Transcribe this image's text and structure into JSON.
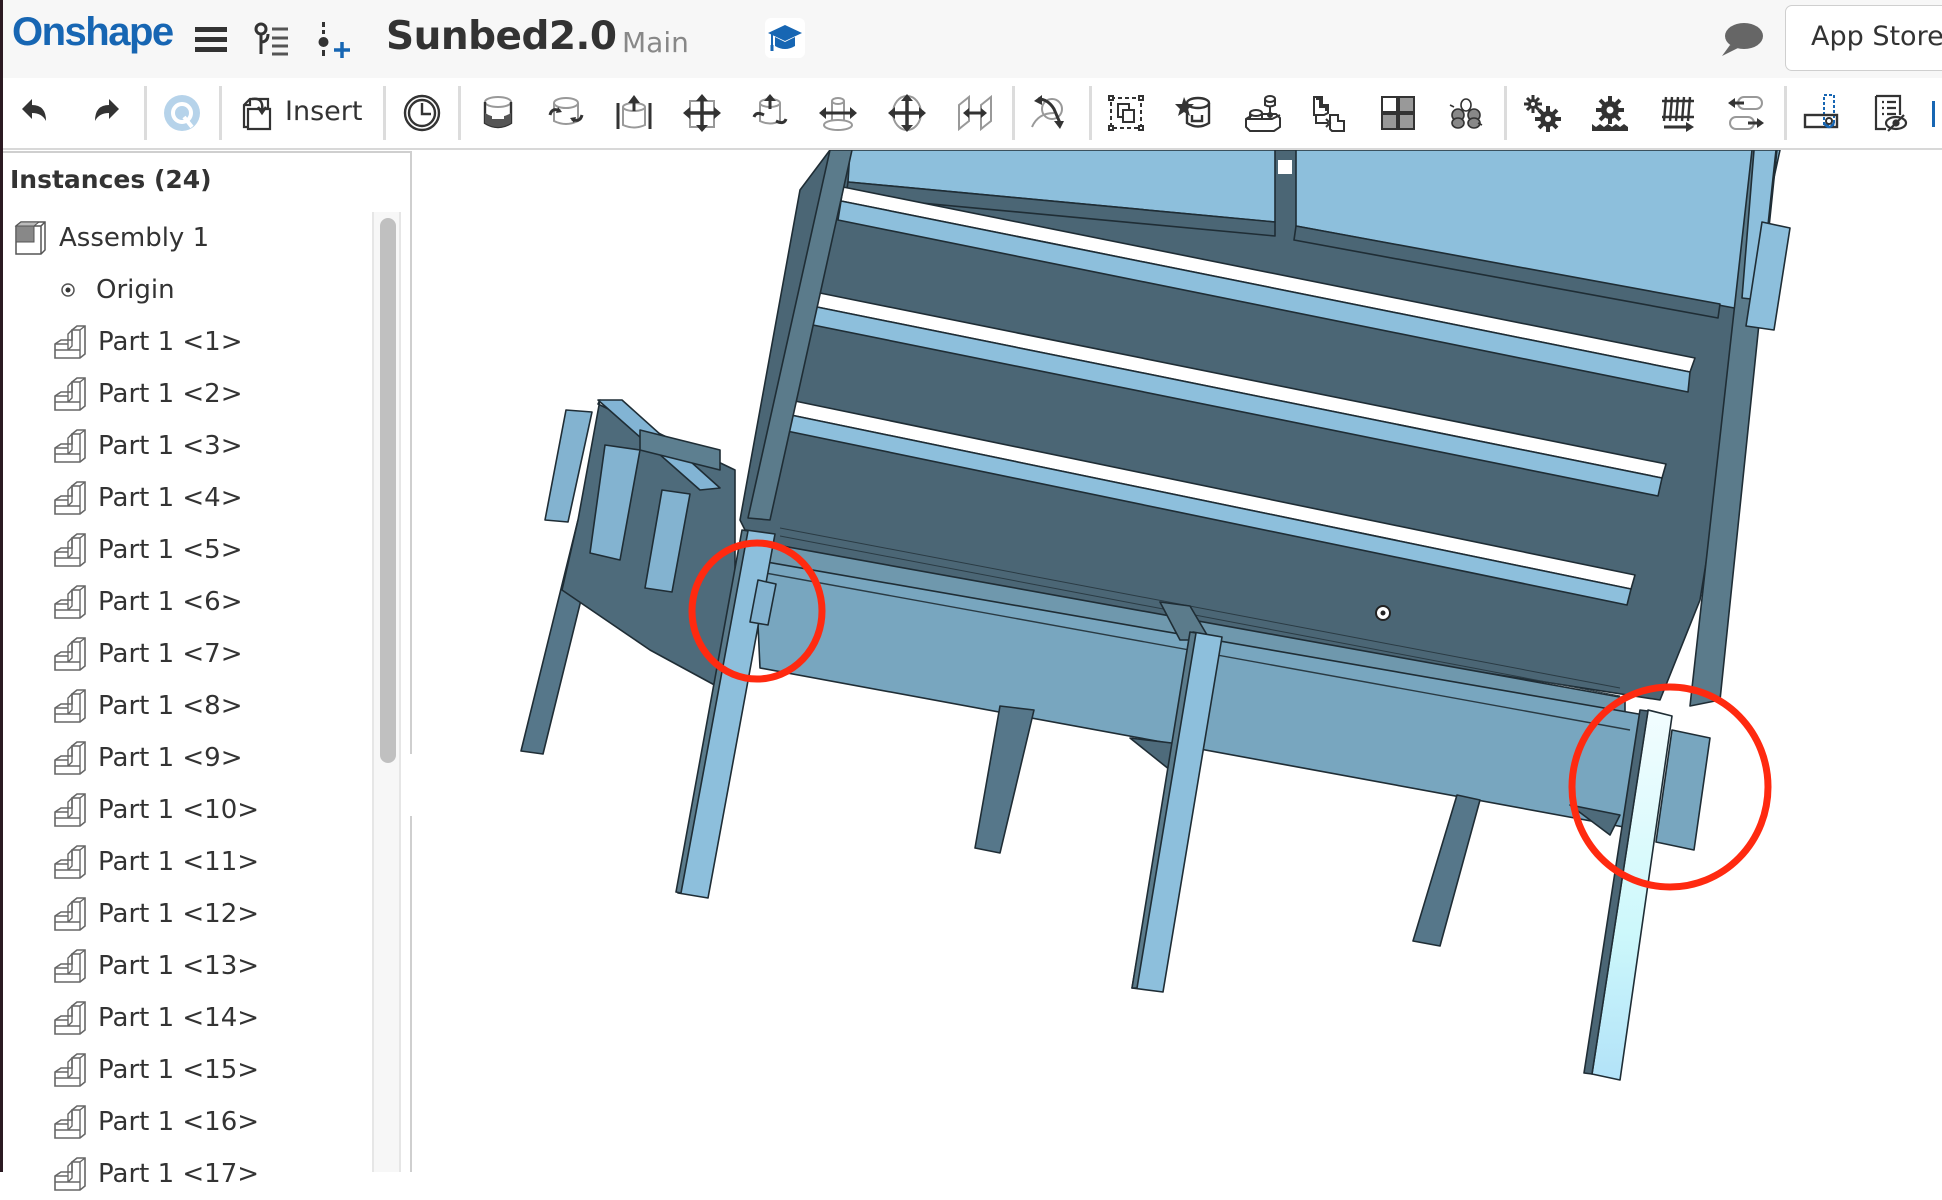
{
  "app": {
    "logo": "Onshape",
    "document_title": "Sunbed2.0",
    "branch": "Main",
    "app_store_label": "App Store"
  },
  "header_icons": [
    {
      "name": "hamburger-menu-icon"
    },
    {
      "name": "version-graph-icon"
    },
    {
      "name": "insert-mate-connector-icon"
    },
    {
      "name": "learning-center-icon"
    },
    {
      "name": "comment-icon"
    }
  ],
  "toolbar": {
    "insert_label": "Insert",
    "tools": [
      "undo",
      "redo",
      "regenerate",
      "insert",
      "named-positions",
      "fastened-mate",
      "revolute-mate",
      "slider-mate",
      "planar-mate",
      "cylindrical-mate",
      "pin-slot-mate",
      "ball-mate",
      "parallel-mate",
      "tangent-mate",
      "group",
      "mate-connector",
      "relation",
      "replicate",
      "pattern",
      "mate-limits",
      "gear-relation",
      "rack-pinion-relation",
      "screw-relation",
      "linear-relation",
      "display-states",
      "exploded-view-hide"
    ]
  },
  "panel": {
    "title": "Instances (24)",
    "assembly": "Assembly 1",
    "origin": "Origin",
    "parts": [
      "Part 1 <1>",
      "Part 1 <2>",
      "Part 1 <3>",
      "Part 1 <4>",
      "Part 1 <5>",
      "Part 1 <6>",
      "Part 1 <7>",
      "Part 1 <8>",
      "Part 1 <9>",
      "Part 1 <10>",
      "Part 1 <11>",
      "Part 1 <12>",
      "Part 1 <13>",
      "Part 1 <14>",
      "Part 1 <15>",
      "Part 1 <16>",
      "Part 1 <17>"
    ]
  },
  "viewport": {
    "model": "Sunbed assembly (3D)",
    "annotations": [
      "red-circle-left-joint",
      "red-circle-right-joint"
    ]
  },
  "colors": {
    "brand": "#1766b3",
    "model_light": "#8dbfdc",
    "model_mid": "#78a6bf",
    "model_dark": "#4b6675",
    "annotation_red": "#ff2a10"
  }
}
